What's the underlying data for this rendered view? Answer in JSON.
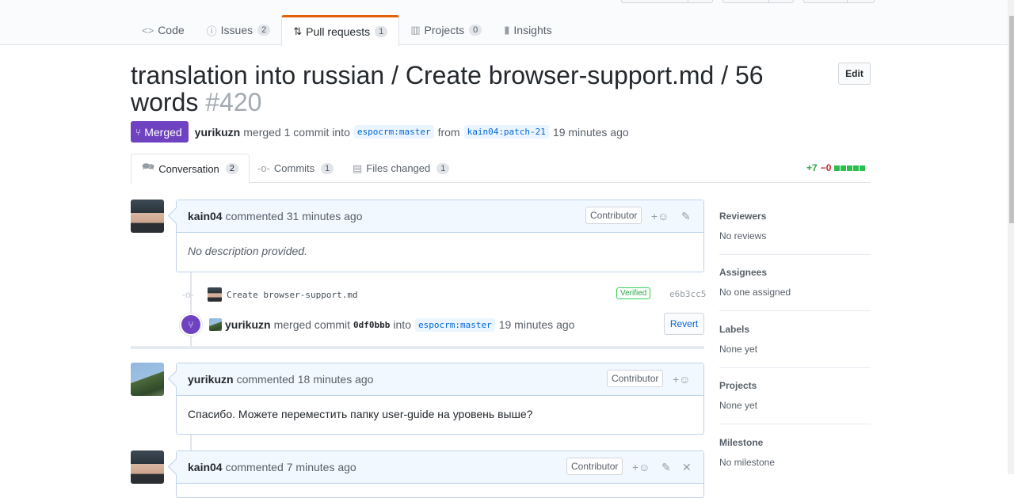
{
  "repo_nav": {
    "tabs": [
      {
        "icon": "code-icon",
        "glyph": "<>",
        "label": "Code",
        "count": ""
      },
      {
        "icon": "issue-icon",
        "glyph": "ⓘ",
        "label": "Issues",
        "count": "2"
      },
      {
        "icon": "pull-request-icon",
        "glyph": "⇅",
        "label": "Pull requests",
        "count": "1"
      },
      {
        "icon": "project-icon",
        "glyph": "▥",
        "label": "Projects",
        "count": "0"
      },
      {
        "icon": "graph-icon",
        "glyph": "▮",
        "label": "Insights",
        "count": ""
      }
    ]
  },
  "pr": {
    "title": "translation into russian / Create browser-support.md / 56 words",
    "number": "#420",
    "edit_label": "Edit",
    "state": "Merged",
    "author": "yurikuzn",
    "merged_text": "merged 1 commit into",
    "base_branch": "espocrm:master",
    "from_text": "from",
    "head_branch": "kain04:patch-21",
    "time": "19 minutes ago"
  },
  "pr_tabs": {
    "conversation": {
      "label": "Conversation",
      "count": "2"
    },
    "commits": {
      "label": "Commits",
      "count": "1"
    },
    "files": {
      "label": "Files changed",
      "count": "1"
    }
  },
  "diffstat": {
    "added": "+7",
    "removed": "−0"
  },
  "comments": [
    {
      "author": "kain04",
      "action": "commented",
      "time": "31 minutes ago",
      "badge": "Contributor",
      "body": "No description provided."
    },
    {
      "author": "yurikuzn",
      "action": "commented",
      "time": "18 minutes ago",
      "badge": "Contributor",
      "body": "Спасибо. Можете переместить папку user-guide на уровень выше?"
    },
    {
      "author": "kain04",
      "action": "commented",
      "time": "7 minutes ago",
      "badge": "Contributor",
      "body": ""
    }
  ],
  "commit": {
    "message": "Create browser-support.md",
    "verified": "Verified",
    "sha": "e6b3cc5"
  },
  "merge_event": {
    "author": "yurikuzn",
    "text": "merged commit",
    "sha": "0df0bbb",
    "into": "into",
    "branch": "espocrm:master",
    "time": "19 minutes ago",
    "revert_label": "Revert"
  },
  "sidebar": {
    "reviewers": {
      "label": "Reviewers",
      "value": "No reviews"
    },
    "assignees": {
      "label": "Assignees",
      "value": "No one assigned"
    },
    "labels": {
      "label": "Labels",
      "value": "None yet"
    },
    "projects": {
      "label": "Projects",
      "value": "None yet"
    },
    "milestone": {
      "label": "Milestone",
      "value": "No milestone"
    }
  },
  "colors": {
    "merged": "#6f42c1",
    "accent_tab": "#e36209",
    "link": "#0366d6",
    "add": "#28a745",
    "del": "#cb2431"
  }
}
